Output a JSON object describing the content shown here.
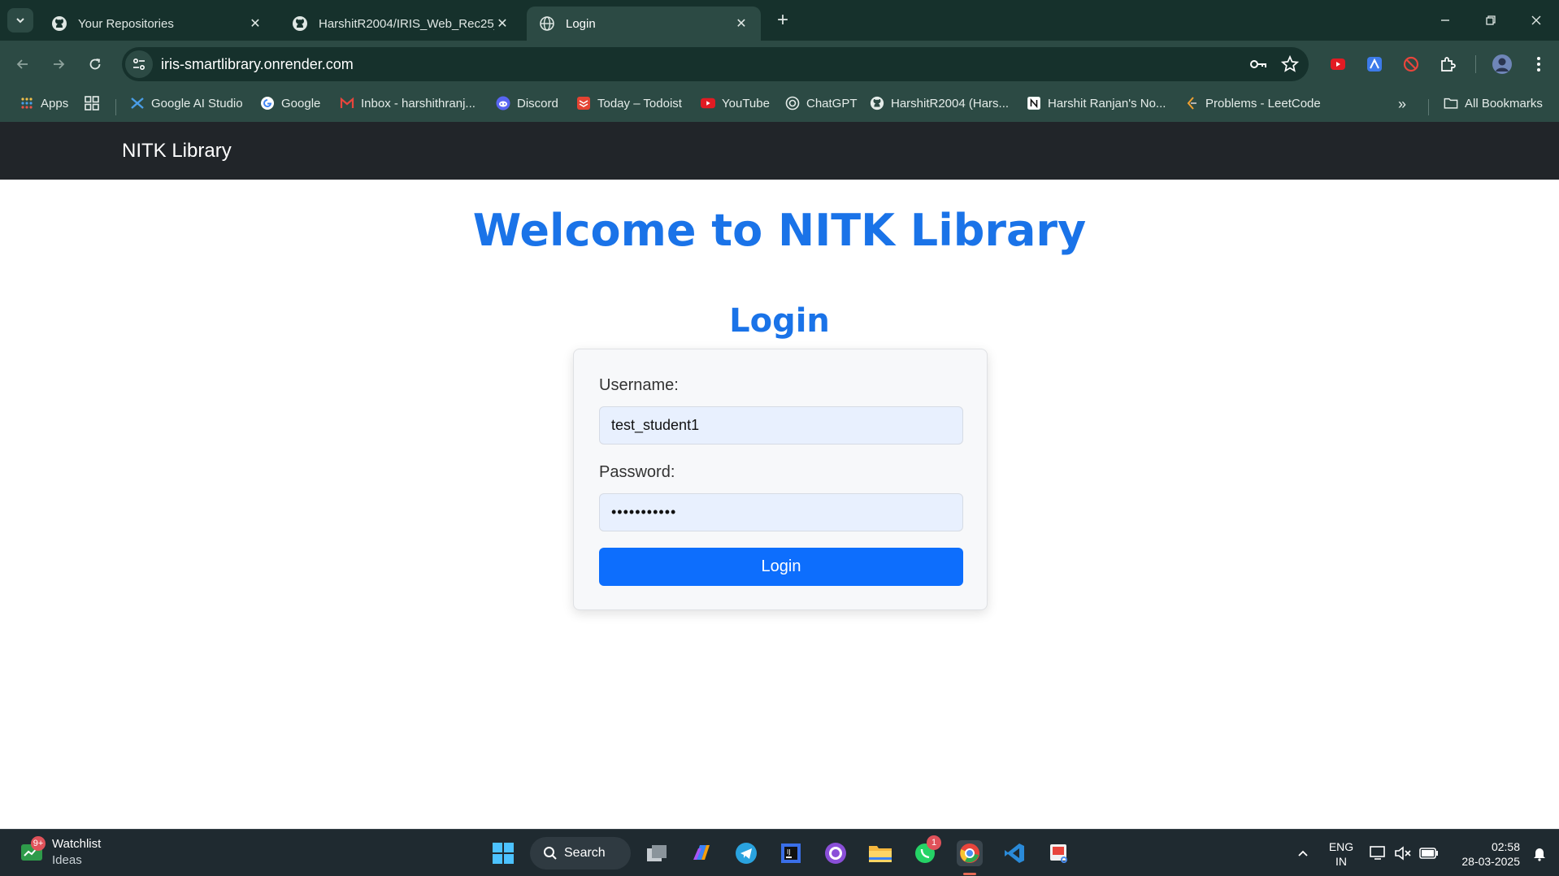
{
  "browser": {
    "tabs": [
      {
        "title": "Your Repositories",
        "icon": "github-icon"
      },
      {
        "title": "HarshitR2004/IRIS_Web_Rec25_",
        "icon": "github-icon"
      },
      {
        "title": "Login",
        "icon": "globe-icon",
        "active": true
      }
    ],
    "url": "iris-smartlibrary.onrender.com",
    "bookmarks": [
      {
        "label": "Apps"
      },
      {
        "label": "Google AI Studio"
      },
      {
        "label": "Google"
      },
      {
        "label": "Inbox - harshithranj..."
      },
      {
        "label": "Discord"
      },
      {
        "label": "Today – Todoist"
      },
      {
        "label": "YouTube"
      },
      {
        "label": "ChatGPT"
      },
      {
        "label": "HarshitR2004 (Hars..."
      },
      {
        "label": "Harshit Ranjan's No..."
      },
      {
        "label": "Problems - LeetCode"
      }
    ],
    "all_bookmarks": "All Bookmarks"
  },
  "page": {
    "brand": "NITK Library",
    "welcome": "Welcome to NITK Library",
    "login_title": "Login",
    "form": {
      "username_label": "Username:",
      "username_value": "test_student1",
      "password_label": "Password:",
      "password_value": "•••••••••••",
      "submit_label": "Login"
    }
  },
  "taskbar": {
    "widget_title": "Watchlist",
    "widget_sub": "Ideas",
    "widget_badge": "9+",
    "search_label": "Search",
    "whatsapp_badge": "1",
    "lang_top": "ENG",
    "lang_bottom": "IN",
    "time": "02:58",
    "date": "28-03-2025"
  },
  "colors": {
    "accent": "#1a73e8",
    "button": "#0d6efd",
    "navbar": "#212529",
    "chrome": "#2c4a44"
  }
}
